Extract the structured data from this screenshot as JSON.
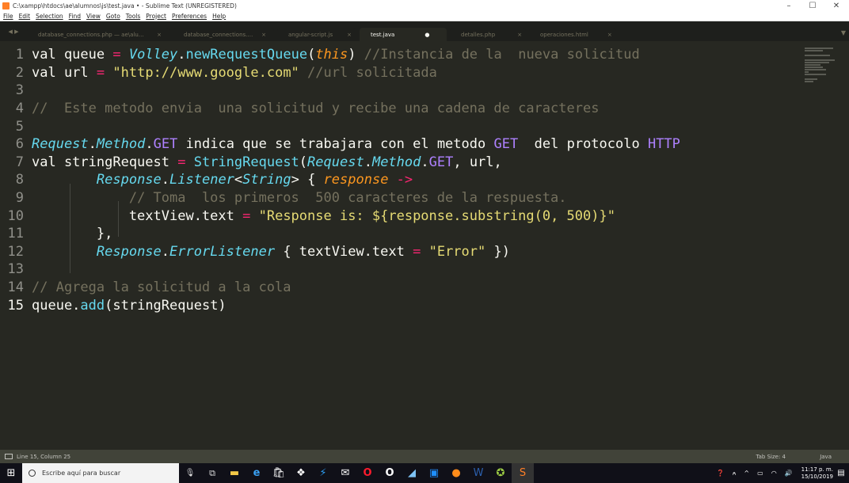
{
  "window": {
    "title": "C:\\xampp\\htdocs\\ae\\alumnos\\js\\test.java • - Sublime Text (UNREGISTERED)",
    "min_glyph": "–",
    "max_glyph": "☐",
    "close_glyph": "✕"
  },
  "menu": [
    "File",
    "Edit",
    "Selection",
    "Find",
    "View",
    "Goto",
    "Tools",
    "Project",
    "Preferences",
    "Help"
  ],
  "tabs": [
    {
      "label": "database_connections.php — ae\\alumnos\\databaseFiles",
      "close": "×",
      "active": false
    },
    {
      "label": "database_connections.php — ae",
      "close": "×",
      "active": false
    },
    {
      "label": "angular-script.js",
      "close": "×",
      "active": false
    },
    {
      "label": "test.java",
      "close": "●",
      "active": true
    },
    {
      "label": "detalles.php",
      "close": "×",
      "active": false
    },
    {
      "label": "operaciones.html",
      "close": "×",
      "active": false
    }
  ],
  "tab_nav": "◀ ▶",
  "tab_overflow": "▼",
  "editor": {
    "line_numbers": [
      "1",
      "2",
      "3",
      "4",
      "5",
      "6",
      "7",
      "8",
      "9",
      "10",
      "11",
      "12",
      "13",
      "14",
      "15"
    ],
    "current_line": 15,
    "lines": [
      [
        {
          "t": "val queue ",
          "c": "code"
        },
        {
          "t": "=",
          "c": "op"
        },
        {
          "t": " ",
          "c": "code"
        },
        {
          "t": "Volley",
          "c": "kw-i"
        },
        {
          "t": ".",
          "c": "code"
        },
        {
          "t": "newRequestQueue",
          "c": "fn"
        },
        {
          "t": "(",
          "c": "code"
        },
        {
          "t": "this",
          "c": "this"
        },
        {
          "t": ") ",
          "c": "code"
        },
        {
          "t": "//Instancia de la  nueva solicitud",
          "c": "cmt"
        }
      ],
      [
        {
          "t": "val url ",
          "c": "code"
        },
        {
          "t": "=",
          "c": "op"
        },
        {
          "t": " ",
          "c": "code"
        },
        {
          "t": "\"http://www.google.com\"",
          "c": "str"
        },
        {
          "t": " ",
          "c": "code"
        },
        {
          "t": "//url solicitada",
          "c": "cmt"
        }
      ],
      [],
      [
        {
          "t": "//  Este metodo envia  una solicitud y recibe una cadena de caracteres",
          "c": "cmt"
        }
      ],
      [],
      [
        {
          "t": "Request",
          "c": "kw-i"
        },
        {
          "t": ".",
          "c": "code"
        },
        {
          "t": "Method",
          "c": "kw-i"
        },
        {
          "t": ".",
          "c": "code"
        },
        {
          "t": "GET",
          "c": "const"
        },
        {
          "t": " indica que se trabajara con el metodo ",
          "c": "code"
        },
        {
          "t": "GET",
          "c": "const"
        },
        {
          "t": "  del protocolo ",
          "c": "code"
        },
        {
          "t": "HTTP",
          "c": "const"
        }
      ],
      [
        {
          "t": "val stringRequest ",
          "c": "code"
        },
        {
          "t": "=",
          "c": "op"
        },
        {
          "t": " ",
          "c": "code"
        },
        {
          "t": "StringRequest",
          "c": "fn"
        },
        {
          "t": "(",
          "c": "code"
        },
        {
          "t": "Request",
          "c": "kw-i"
        },
        {
          "t": ".",
          "c": "code"
        },
        {
          "t": "Method",
          "c": "kw-i"
        },
        {
          "t": ".",
          "c": "code"
        },
        {
          "t": "GET",
          "c": "const"
        },
        {
          "t": ", url,",
          "c": "code"
        }
      ],
      [
        {
          "t": "        ",
          "c": "code"
        },
        {
          "t": "Response",
          "c": "kw-i"
        },
        {
          "t": ".",
          "c": "code"
        },
        {
          "t": "Listener",
          "c": "kw-i"
        },
        {
          "t": "<",
          "c": "code"
        },
        {
          "t": "String",
          "c": "kw-i"
        },
        {
          "t": "> { ",
          "c": "code"
        },
        {
          "t": "response",
          "c": "param"
        },
        {
          "t": " ->",
          "c": "op"
        }
      ],
      [
        {
          "t": "            ",
          "c": "code"
        },
        {
          "t": "// Toma  los primeros  500 caracteres de la respuesta.",
          "c": "cmt"
        }
      ],
      [
        {
          "t": "            textView.text ",
          "c": "code"
        },
        {
          "t": "=",
          "c": "op"
        },
        {
          "t": " ",
          "c": "code"
        },
        {
          "t": "\"Response is: ${response.substring(0, 500)}\"",
          "c": "str"
        }
      ],
      [
        {
          "t": "        },",
          "c": "code"
        }
      ],
      [
        {
          "t": "        ",
          "c": "code"
        },
        {
          "t": "Response",
          "c": "kw-i"
        },
        {
          "t": ".",
          "c": "code"
        },
        {
          "t": "ErrorListener",
          "c": "kw-i"
        },
        {
          "t": " { textView.text ",
          "c": "code"
        },
        {
          "t": "=",
          "c": "op"
        },
        {
          "t": " ",
          "c": "code"
        },
        {
          "t": "\"Error\"",
          "c": "str"
        },
        {
          "t": " })",
          "c": "code"
        }
      ],
      [],
      [
        {
          "t": "// Agrega la solicitud a la cola",
          "c": "cmt"
        }
      ],
      [
        {
          "t": "queue.",
          "c": "code"
        },
        {
          "t": "add",
          "c": "fn"
        },
        {
          "t": "(stringRequest)",
          "c": "code"
        }
      ]
    ]
  },
  "status": {
    "position": "Line 15, Column 25",
    "tab_size": "Tab Size: 4",
    "syntax": "Java"
  },
  "taskbar": {
    "search_placeholder": "Escribe aquí para buscar",
    "time": "11:17 p. m.",
    "date": "15/10/2019"
  },
  "colors": {
    "background": "#272822",
    "comment": "#75715e",
    "string": "#e6db74",
    "keyword": "#66d9ef",
    "operator": "#f92672",
    "constant": "#ae81ff",
    "parameter": "#fd971f"
  }
}
